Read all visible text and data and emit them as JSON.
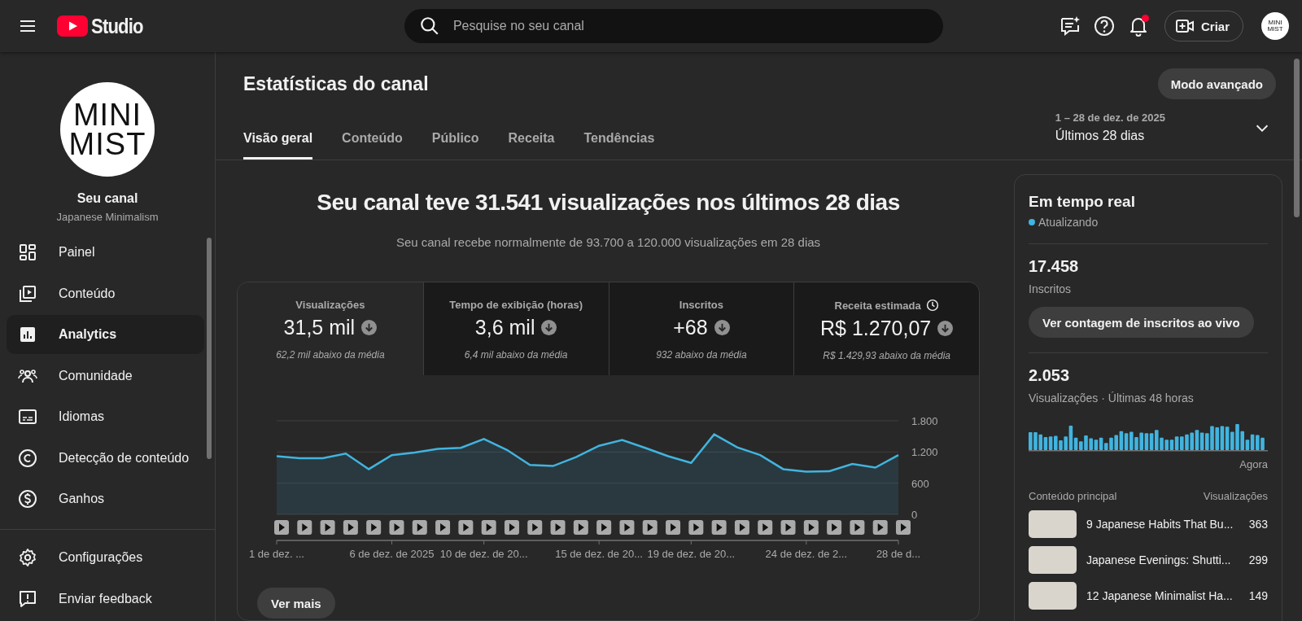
{
  "header": {
    "logo_text": "Studio",
    "search": {
      "placeholder": "Pesquise no seu canal"
    },
    "notification_dot": true,
    "create_button": "Criar",
    "avatar_lines": [
      "MINI",
      "MIST"
    ]
  },
  "sidebar": {
    "channel": {
      "logo_lines": [
        "MINI",
        "MIST"
      ],
      "title": "Seu canal",
      "subtitle": "Japanese Minimalism"
    },
    "items": [
      {
        "kind": "dashboard",
        "label": "Painel",
        "selected": false
      },
      {
        "kind": "content",
        "label": "Conteúdo",
        "selected": false
      },
      {
        "kind": "analytics",
        "label": "Analytics",
        "selected": true
      },
      {
        "kind": "community",
        "label": "Comunidade",
        "selected": false
      },
      {
        "kind": "subtitles",
        "label": "Idiomas",
        "selected": false
      },
      {
        "kind": "copyright",
        "label": "Detecção de conteúdo",
        "selected": false
      },
      {
        "kind": "earnings",
        "label": "Ganhos",
        "selected": false
      }
    ],
    "footer_items": [
      {
        "kind": "settings",
        "label": "Configurações"
      },
      {
        "kind": "feedback",
        "label": "Enviar feedback"
      }
    ]
  },
  "page": {
    "title": "Estatísticas do canal",
    "advanced_button": "Modo avançado",
    "tabs": [
      {
        "label": "Visão geral",
        "selected": true
      },
      {
        "label": "Conteúdo",
        "selected": false
      },
      {
        "label": "Público",
        "selected": false
      },
      {
        "label": "Receita",
        "selected": false
      },
      {
        "label": "Tendências",
        "selected": false
      }
    ],
    "date_range": {
      "dates": "1 – 28 de dez. de 2025",
      "period": "Últimos 28 dias"
    }
  },
  "summary": {
    "headline": "Seu canal teve 31.541 visualizações nos últimos 28 dias",
    "subline": "Seu canal recebe normalmente de 93.700 a 120.000 visualizações em 28 dias"
  },
  "metrics": [
    {
      "label": "Visualizações",
      "value": "31,5 mil",
      "note": "62,2 mil abaixo da média",
      "selected": true,
      "clock": false
    },
    {
      "label": "Tempo de exibição (horas)",
      "value": "3,6 mil",
      "note": "6,4 mil abaixo da média",
      "selected": false,
      "clock": false
    },
    {
      "label": "Inscritos",
      "value": "+68",
      "note": "932 abaixo da média",
      "selected": false,
      "clock": false
    },
    {
      "label": "Receita estimada",
      "value": "R$ 1.270,07",
      "note": "R$ 1.429,93 abaixo da média",
      "selected": false,
      "clock": true
    }
  ],
  "chart_data": {
    "type": "area",
    "categories": [
      "1 de dez. ...",
      null,
      null,
      null,
      null,
      "6 de dez. de 2025",
      null,
      null,
      null,
      "10 de dez. de 20...",
      null,
      null,
      null,
      null,
      "15 de dez. de 20...",
      null,
      null,
      null,
      "19 de dez. de 20...",
      null,
      null,
      null,
      null,
      "24 de dez. de 2...",
      null,
      null,
      null,
      "28 de d..."
    ],
    "series": [
      {
        "color": "#41b4df",
        "values": [
          1120,
          1080,
          1080,
          1170,
          870,
          1140,
          1190,
          1260,
          1280,
          1450,
          1240,
          950,
          930,
          1100,
          1320,
          1430,
          1280,
          1120,
          990,
          1540,
          1290,
          1140,
          870,
          820,
          830,
          970,
          900,
          1140
        ]
      }
    ],
    "ylim": [
      0,
      1800
    ],
    "yticks": [
      {
        "value": 0,
        "label": "0"
      },
      {
        "value": 600,
        "label": "600"
      },
      {
        "value": 1200,
        "label": "1.200"
      },
      {
        "value": 1800,
        "label": "1.800"
      }
    ]
  },
  "more_button": "Ver mais",
  "realtime": {
    "title": "Em tempo real",
    "status": "Atualizando",
    "subscribers": {
      "value": "17.458",
      "label": "Inscritos"
    },
    "live_button": "Ver contagem de inscritos ao vivo",
    "views": {
      "value": "2.053",
      "label": "Visualizações · Últimas 48 horas"
    },
    "axis_end": "Agora",
    "top_content": {
      "column_1": "Conteúdo principal",
      "column_2": "Visualizações",
      "rows": [
        {
          "title": "9 Japanese Habits That Bu...",
          "views": "363"
        },
        {
          "title": "Japanese Evenings: Shutti...",
          "views": "299"
        },
        {
          "title": "12 Japanese Minimalist Ha...",
          "views": "149"
        }
      ]
    }
  }
}
